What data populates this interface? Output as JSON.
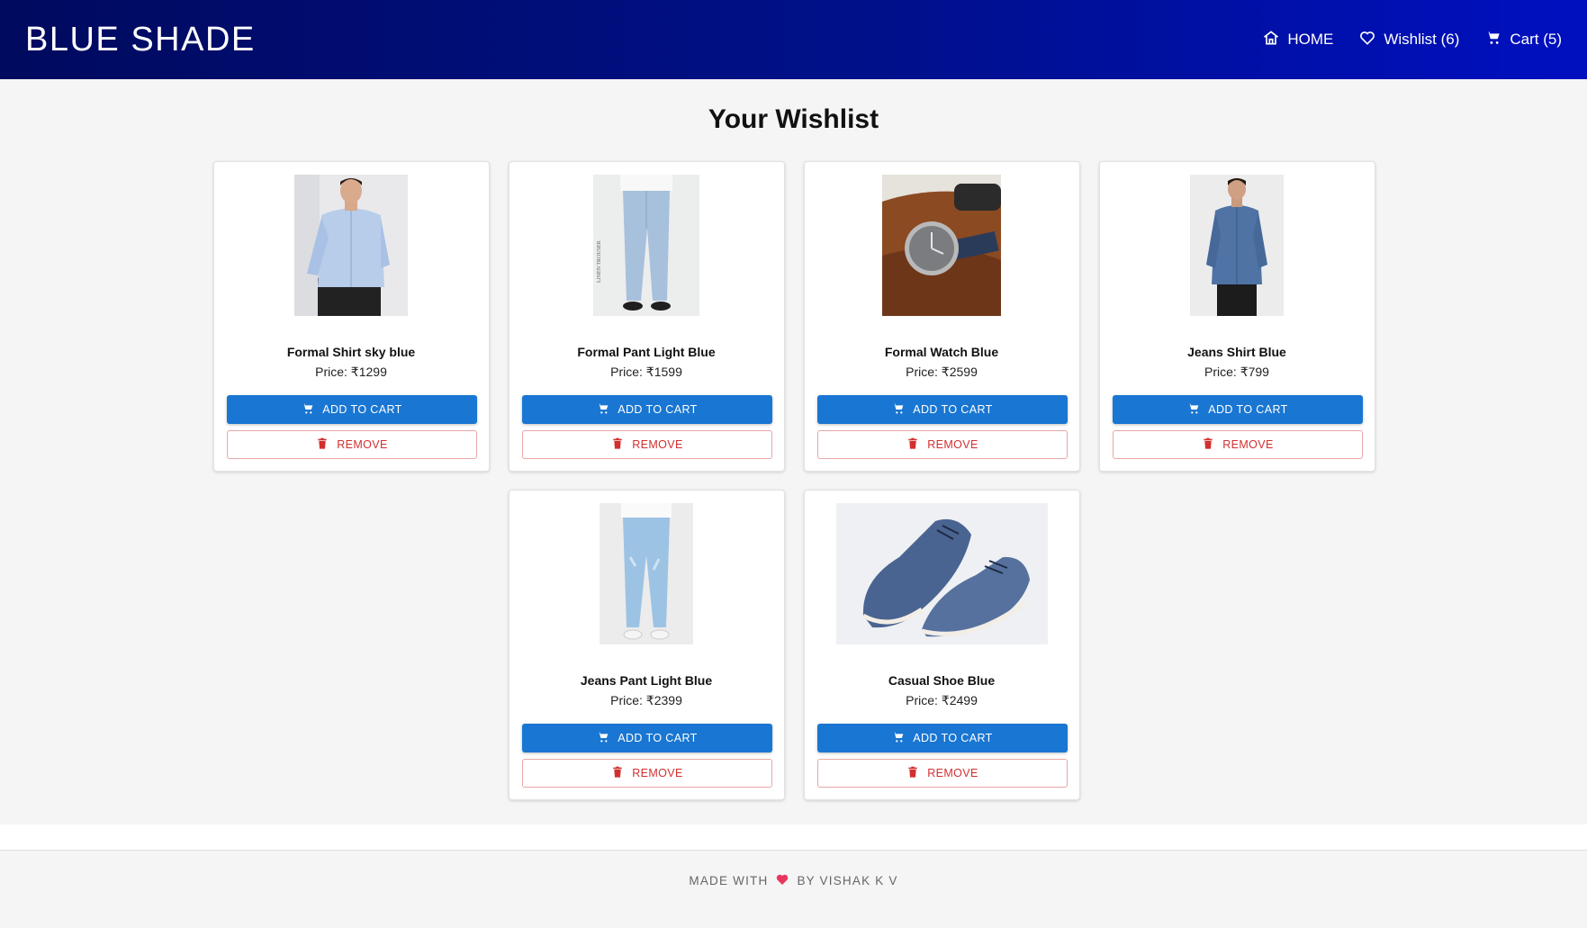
{
  "header": {
    "brand": "BLUE SHADE",
    "nav": {
      "home": "HOME",
      "wishlist": "Wishlist (6)",
      "cart": "Cart (5)"
    }
  },
  "page": {
    "title": "Your Wishlist"
  },
  "buttons": {
    "add_to_cart": "ADD TO CART",
    "remove": "REMOVE"
  },
  "products": [
    {
      "name": "Formal Shirt sky blue",
      "price": "Price: ₹1299",
      "image": "formal-shirt-photo"
    },
    {
      "name": "Formal Pant Light Blue",
      "price": "Price: ₹1599",
      "image": "formal-pant-photo"
    },
    {
      "name": "Formal Watch Blue",
      "price": "Price: ₹2599",
      "image": "formal-watch-photo"
    },
    {
      "name": "Jeans Shirt Blue",
      "price": "Price: ₹799",
      "image": "jeans-shirt-photo"
    },
    {
      "name": "Jeans Pant Light Blue",
      "price": "Price: ₹2399",
      "image": "jeans-pant-photo"
    },
    {
      "name": "Casual Shoe Blue",
      "price": "Price: ₹2499",
      "image": "casual-shoe-photo"
    }
  ],
  "footer": {
    "prefix": "MADE WITH",
    "suffix": "BY VISHAK K V",
    "icon": "heart-icon"
  },
  "colors": {
    "header_start": "#000a5e",
    "header_end": "#0010c0",
    "primary": "#1976d2",
    "danger": "#d32f2f",
    "heart": "#e8365d",
    "background": "#f5f5f5"
  }
}
